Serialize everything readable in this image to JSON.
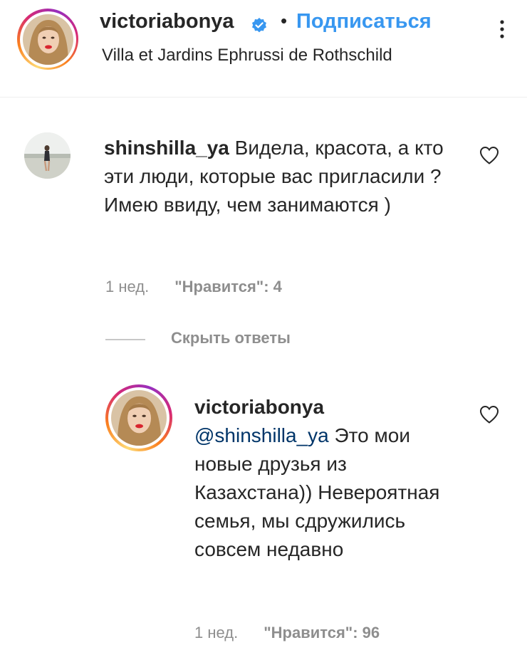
{
  "header": {
    "username": "victoriabonya",
    "dot": "•",
    "follow_label": "Подписаться",
    "location": "Villa et Jardins Ephrussi de Rothschild",
    "verified_icon": "verified-badge-icon"
  },
  "comments": [
    {
      "username": "shinshilla_ya",
      "text": " Видела, красота, а кто эти люди, которые вас пригласили ? Имею ввиду, чем занимаются )",
      "time": "1 нед.",
      "likes": "\"Нравится\": 4",
      "hide_replies_label": "Скрыть ответы"
    }
  ],
  "reply": {
    "username": "victoriabonya",
    "mention": "@shinshilla_ya",
    "text": " Это мои новые друзья из Казахстана)) Невероятная семья, мы сдружились совсем недавно",
    "time": "1 нед.",
    "likes": "\"Нравится\": 96"
  },
  "colors": {
    "accent": "#3897f0",
    "mention": "#003569",
    "muted": "#8e8e8e",
    "text": "#262626"
  }
}
